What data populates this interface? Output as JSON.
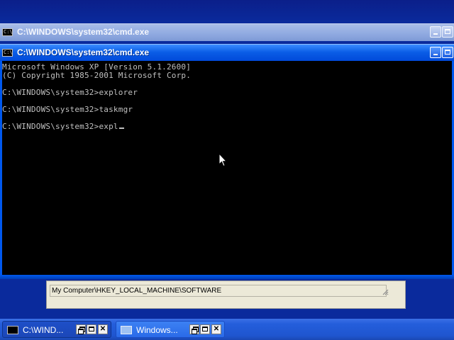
{
  "background_window": {
    "title": "C:\\WINDOWS\\system32\\cmd.exe",
    "icon": "console-icon"
  },
  "front_window": {
    "title": "C:\\WINDOWS\\system32\\cmd.exe",
    "icon": "console-icon",
    "console_lines": [
      "Microsoft Windows XP [Version 5.1.2600]",
      "(C) Copyright 1985-2001 Microsoft Corp.",
      "",
      "C:\\WINDOWS\\system32>explorer",
      "",
      "C:\\WINDOWS\\system32>taskmgr",
      "",
      "C:\\WINDOWS\\system32>expl"
    ],
    "console_fg": "#c0c0c0",
    "console_bg": "#000000"
  },
  "regedit_window": {
    "status_text": "My Computer\\HKEY_LOCAL_MACHINE\\SOFTWARE"
  },
  "taskbar": {
    "buttons": [
      {
        "label": "C:\\WIND...",
        "icon": "console-icon"
      },
      {
        "label": "Windows...",
        "icon": "window-icon"
      }
    ]
  },
  "colors": {
    "active_title": "#0a5de6",
    "inactive_title": "#8fa9e0",
    "taskbar": "#245edb"
  }
}
